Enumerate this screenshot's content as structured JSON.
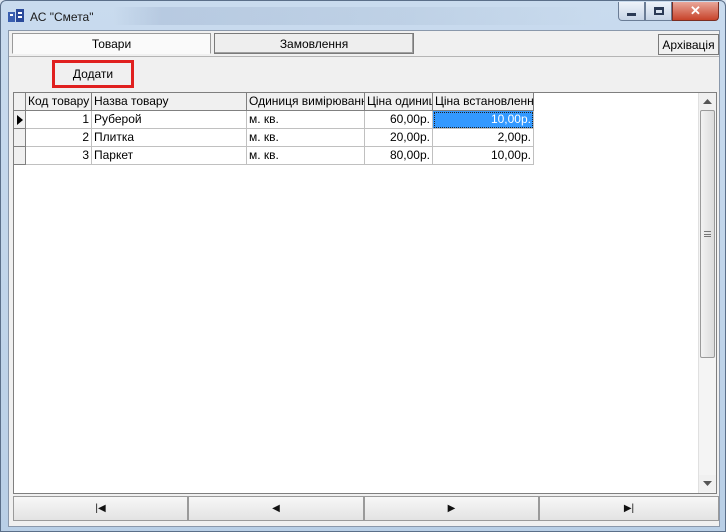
{
  "window": {
    "title": "АС \"Смета\"",
    "app_icon": "app-icon",
    "minimize_icon": "minimize-icon",
    "maximize_icon": "maximize-icon",
    "close_glyph": "✕"
  },
  "tabs": {
    "goods": "Товари",
    "orders": "Замовлення",
    "archive": "Архівація"
  },
  "toolbar": {
    "add_label": "Додати",
    "highlight_color": "#e0201f"
  },
  "grid": {
    "columns": [
      "Код товару",
      "Назва товару",
      "Одиниця вимірювання",
      "Ціна одиниці",
      "Ціна встановлення"
    ],
    "rows": [
      {
        "code": "1",
        "name": "Руберой",
        "unit": "м. кв.",
        "price": "60,00р.",
        "install": "10,00р."
      },
      {
        "code": "2",
        "name": "Плитка",
        "unit": "м. кв.",
        "price": "20,00р.",
        "install": "2,00р."
      },
      {
        "code": "3",
        "name": "Паркет",
        "unit": "м. кв.",
        "price": "80,00р.",
        "install": "10,00р."
      }
    ],
    "selection_color": "#3399ff"
  },
  "navigator": {
    "first": "|◀",
    "prev": "◀",
    "next": "▶",
    "last": "▶|"
  }
}
